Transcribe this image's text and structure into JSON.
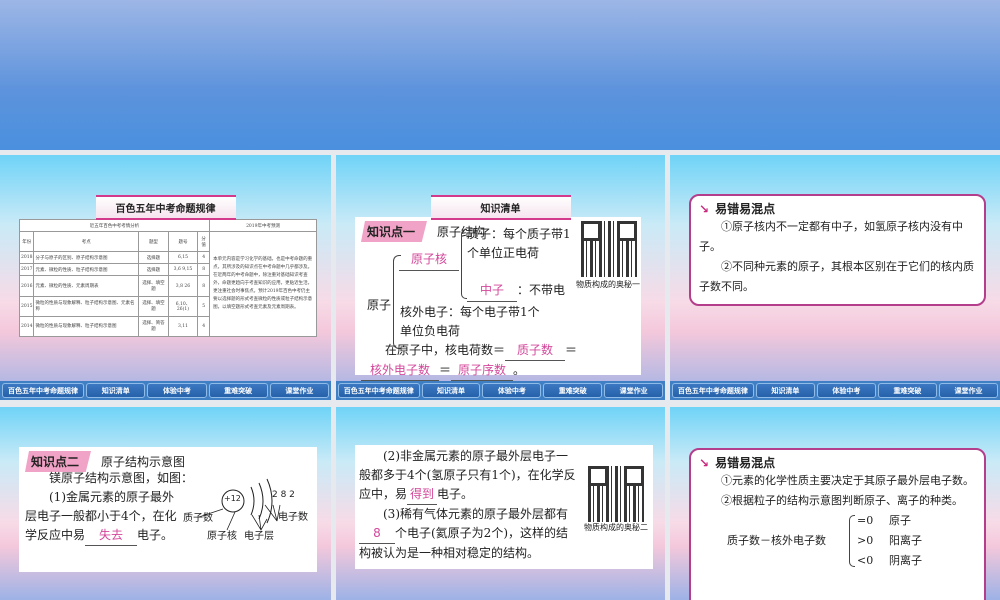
{
  "nav": [
    "百色五年中考命题规律",
    "知识清单",
    "体验中考",
    "重难突破",
    "课堂作业"
  ],
  "s1": {
    "banner": "百色五年中考命题规律",
    "left_title": "近五年百色中考考情分析",
    "right_title": "2019年中考预测",
    "headers": [
      "年份",
      "考点",
      "题型",
      "题号",
      "分值"
    ],
    "rows": [
      [
        "2018",
        "分子与原子的区别、原子结构示意图",
        "选择题",
        "6,15",
        "4"
      ],
      [
        "2017",
        "元素、微粒的性质、粒子结构示意图",
        "选择题",
        "3,6\n9,15",
        "8"
      ],
      [
        "2016",
        "元素、微粒的性质、元素周期表",
        "选择、填空题",
        "3,8\n26",
        "8"
      ],
      [
        "2015",
        "微粒的性质与现象解释、粒子结构示意图、元素名称",
        "选择、填空题",
        "6,10、26(1)",
        "5"
      ],
      [
        "2014",
        "微粒的性质与现象解释、粒子结构示意图",
        "选择、简答题",
        "3,11",
        "4"
      ]
    ],
    "prediction": "本单元内容是学习化学的基础，也是中考命题的重点，其所涉及的知识点在中考命题中几乎都涉及。在近两年的中考命题中，除注重对基础知识考查外，命题更趋向于考查知识的应用，更贴近生活，更注重社会时事焦点。预计2019年百色中考仍主要以选择题的形式考查微粒的性质或粒子结构示意图，以填空题形式考查元素及元素周期表。"
  },
  "s2": {
    "banner": "知识清单",
    "tag": "知识点一",
    "title": "原子结构",
    "atom": "原子",
    "nucleus": "原子核",
    "proton": "质子：每个质子带1个单位正电荷",
    "neutron": "中子",
    "neutron_desc": "：不带电",
    "electron": "核外电子：每个电子带1个单位负电荷",
    "eq_prefix": "在原子中，核电荷数＝",
    "a1": "质子数",
    "eq": "＝",
    "a2": "核外电子数",
    "a3": "原子序数",
    "end": "。",
    "qr_caption": "物质构成的奥秘一"
  },
  "s3": {
    "heading": "易错易混点",
    "p1": "①原子核内不一定都有中子，如氢原子核内没有中子。",
    "p2": "②不同种元素的原子，其根本区别在于它们的核内质子数不同。"
  },
  "s4": {
    "tag": "知识点二",
    "title": "原子结构示意图",
    "intro": "镁原子结构示意图，如图：",
    "p1a": "(1)金属元素的原子最外层电子一般都小于4个，在化学反应中易",
    "a1": "失去",
    "p1b": "电子。",
    "nucleus_charge": "+12",
    "shells": "2 8 2",
    "lbl_proton": "质子数",
    "lbl_nucleus": "原子核",
    "lbl_layer": "电子层",
    "lbl_electron": "电子数"
  },
  "s5": {
    "p2a": "(2)非金属元素的原子最外层电子一般都多于4个(氢原子只有1个)，在化学反应中，易",
    "a1": "得到",
    "p2b": "电子。",
    "p3a": "(3)稀有气体元素的原子最外层都有",
    "a2": "8",
    "p3b": "个电子(氦原子为2个)，这样的结构被认为是一种相对稳定的结构。",
    "qr_caption": "物质构成的奥秘二"
  },
  "s6": {
    "heading": "易错易混点",
    "p1": "①元素的化学性质主要决定于其原子最外层电子数。",
    "p2": "②根据粒子的结构示意图判断原子、离子的种类。",
    "formula": "质子数－核外电子数",
    "cases": [
      [
        "=0",
        "原子"
      ],
      [
        ">0",
        "阳离子"
      ],
      [
        "<0",
        "阴离子"
      ]
    ]
  }
}
